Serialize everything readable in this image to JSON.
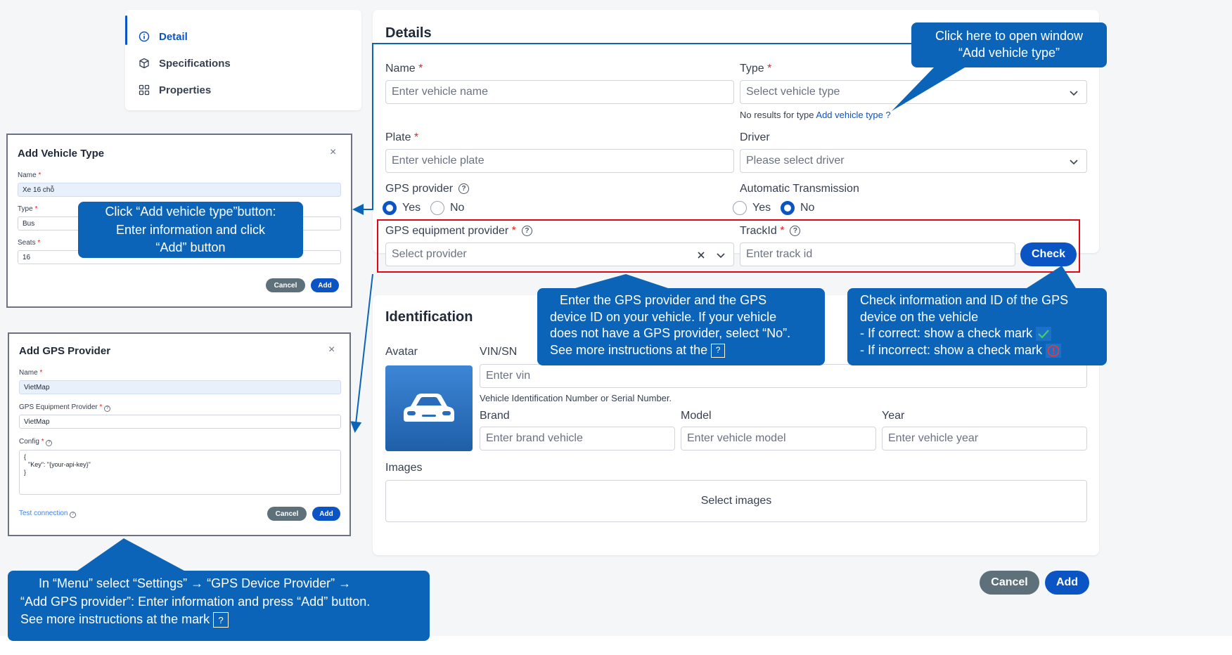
{
  "nav": {
    "items": [
      {
        "label": "Detail",
        "icon": "info-icon"
      },
      {
        "label": "Specifications",
        "icon": "cube-icon"
      },
      {
        "label": "Properties",
        "icon": "grid-icon"
      }
    ]
  },
  "details": {
    "title": "Details",
    "name_label": "Name",
    "name_placeholder": "Enter vehicle name",
    "type_label": "Type",
    "type_placeholder": "Select vehicle type",
    "type_hint": "No results for type",
    "type_hint_link": "Add vehicle type ?",
    "plate_label": "Plate",
    "plate_placeholder": "Enter vehicle plate",
    "driver_label": "Driver",
    "driver_placeholder": "Please select driver",
    "gps_label": "GPS provider",
    "gps_yes": "Yes",
    "gps_no": "No",
    "auto_label": "Automatic Transmission",
    "auto_yes": "Yes",
    "auto_no": "No",
    "gps_equip_label": "GPS equipment provider",
    "gps_equip_placeholder": "Select provider",
    "track_label": "TrackId",
    "track_placeholder": "Enter track id",
    "check_label": "Check",
    "required_mark": "*"
  },
  "identification": {
    "title": "Identification",
    "avatar_label": "Avatar",
    "vin_label": "VIN/SN",
    "vin_placeholder": "Enter vin",
    "vin_hint": "Vehicle Identification Number or Serial Number.",
    "brand_label": "Brand",
    "brand_placeholder": "Enter brand vehicle",
    "model_label": "Model",
    "model_placeholder": "Enter vehicle model",
    "year_label": "Year",
    "year_placeholder": "Enter vehicle year",
    "images_label": "Images",
    "images_button": "Select images"
  },
  "footer": {
    "cancel": "Cancel",
    "add": "Add"
  },
  "dialog_vehicle_type": {
    "title": "Add Vehicle Type",
    "close": "×",
    "name_label": "Name",
    "name_value": "Xe 16 chỗ",
    "type_label": "Type",
    "type_value": "Bus",
    "seats_label": "Seats",
    "seats_value": "16",
    "cancel": "Cancel",
    "add": "Add"
  },
  "dialog_gps": {
    "title": "Add GPS Provider",
    "close": "×",
    "name_label": "Name",
    "name_value": "VietMap",
    "equip_label": "GPS Equipment Provider",
    "equip_value": "VietMap",
    "config_label": "Config",
    "config_line1": "{",
    "config_line2": "\"Key\": \"{your-api-key}\"",
    "config_line3": "}",
    "test_link": "Test connection",
    "cancel": "Cancel",
    "add": "Add"
  },
  "callouts": {
    "add_type_line1": "Click here to open window",
    "add_type_line2": "“Add vehicle type”",
    "dialog_type_line1": "Click “Add vehicle type”button:",
    "dialog_type_line2": "Enter information and click",
    "dialog_type_line3": "“Add” button",
    "gps_line1": "Enter the GPS provider and the GPS",
    "gps_line2": "device ID on your vehicle. If your vehicle",
    "gps_line3": "does not have a GPS provider, select “No”.",
    "gps_line4": "See more instructions at the",
    "check_line1": "Check information and ID of the GPS",
    "check_line2": "device on the vehicle",
    "check_line3": "- If correct: show a check mark",
    "check_line4": "- If incorrect: show a check mark",
    "menu_line1": "In “Menu” select “Settings” → “GPS Device Provider” →",
    "menu_line2": "“Add GPS provider”: Enter information and press “Add” button.",
    "menu_line3": "See more instructions at the mark"
  },
  "colors": {
    "accent": "#0b54c3",
    "callout": "#0b64b8",
    "highlight": "#e30613",
    "gray_button": "#5e7079"
  }
}
